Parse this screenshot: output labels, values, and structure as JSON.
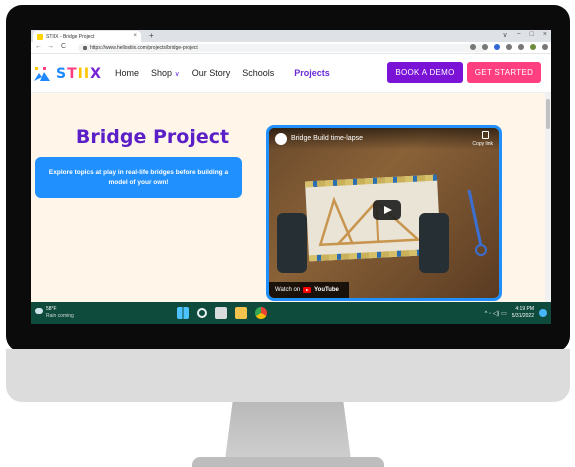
{
  "browser": {
    "tab_title": "STIIX - Bridge Project",
    "tab_close": "×",
    "new_tab": "+",
    "back": "←",
    "forward": "→",
    "reload": "C",
    "url": "https://www.hellostiix.com/projects/bridge-project",
    "window_controls": {
      "minimize": "∨",
      "restore": "−",
      "maximize": "□",
      "close": "×"
    }
  },
  "site": {
    "logo_text": [
      "S",
      "T",
      "II",
      "X"
    ],
    "nav": {
      "home": "Home",
      "shop": "Shop",
      "shop_chevron": "∨",
      "our_story": "Our Story",
      "schools": "Schools",
      "projects": "Projects"
    },
    "book_demo": "BOOK A DEMO",
    "get_started": "GET STARTED"
  },
  "page": {
    "title": "Bridge Project",
    "intro": "Explore topics at play in real-life bridges before building a model of your own!"
  },
  "video": {
    "title": "Bridge Build time-lapse",
    "copy_link": "Copy link",
    "watch_on": "Watch on",
    "youtube": "YouTube"
  },
  "taskbar": {
    "temperature": "58°F",
    "forecast": "Rain coming",
    "tray": "^  ◦  ◁)  ▭",
    "time": "4:19 PM",
    "date": "5/31/2022"
  },
  "colors": {
    "brand_purple": "#7a13d6",
    "brand_pink": "#ff3f7f",
    "brand_blue": "#2190ff",
    "title_purple": "#5b1fc7",
    "page_bg": "#fff5e8",
    "taskbar_bg": "#0e4b3c"
  }
}
